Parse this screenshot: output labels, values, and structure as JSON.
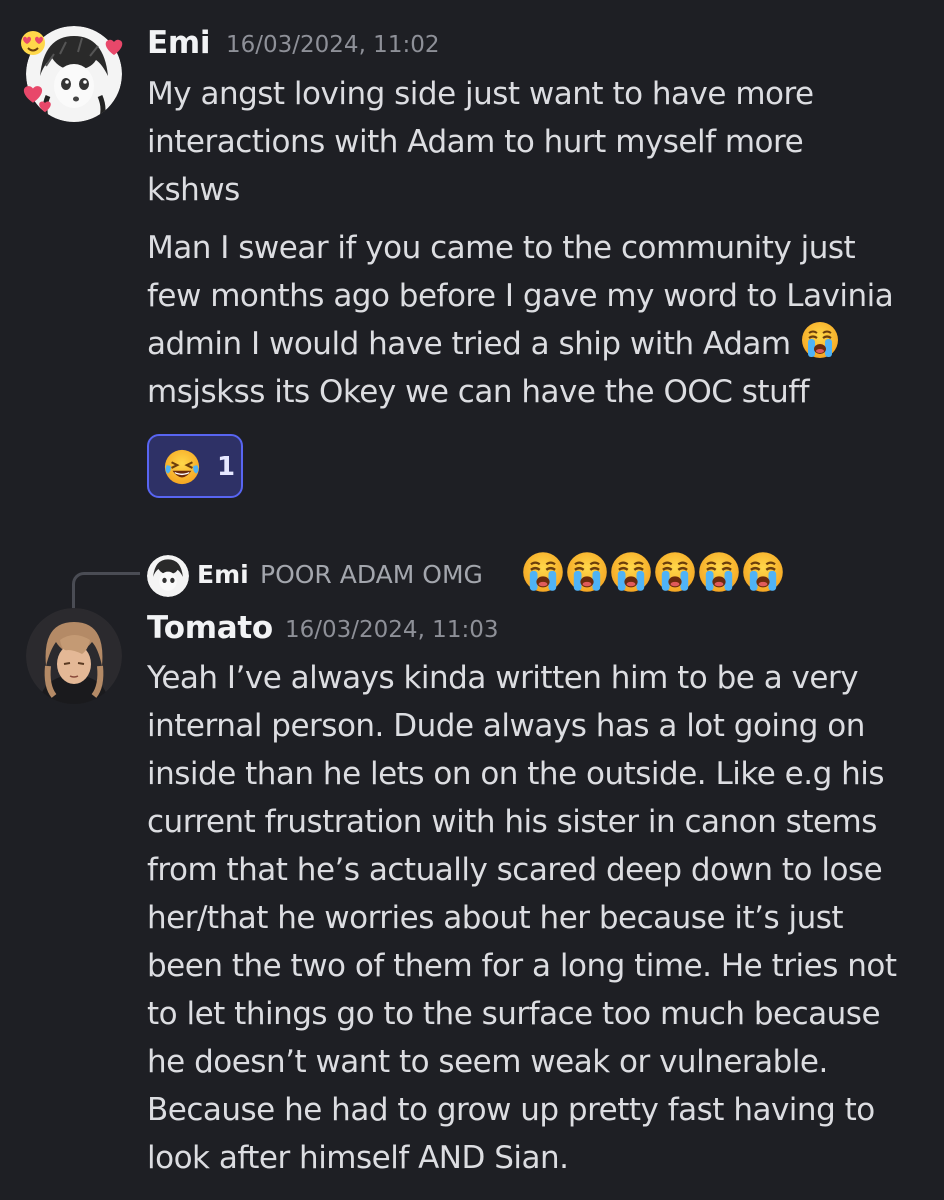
{
  "messages": [
    {
      "username": "Emi",
      "timestamp": "16/03/2024, 11:02",
      "avatar": "manga-girl-avatar",
      "paragraphs": [
        "My angst loving side just want to have more interactions with Adam to hurt myself more kshws",
        "Man I swear if you came to the community just few months ago before I gave my word to Lavinia admin I would have tried a ship with Adam",
        "msjskss its Okey we can have the OOC stuff"
      ],
      "reaction": {
        "emoji": "laughing-crying-emoji",
        "count": "1"
      }
    },
    {
      "username": "Tomato",
      "timestamp": "16/03/2024, 11:03",
      "avatar": "anime-character-avatar",
      "reply": {
        "username": "Emi",
        "text": "POOR ADAM OMG",
        "emoji": "loudly-crying-emoji",
        "emoji_count": 6
      },
      "paragraphs": [
        "Yeah I’ve always kinda written him to be a very internal person. Dude always has a lot going on inside than he lets on on the outside. Like e.g his current frustration with his sister in canon stems from that he’s actually scared deep down to lose her/that he worries about her because it’s just been the two of them for a long time. He tries not to let things go to the surface too much because he doesn’t want to seem weak or vulnerable. Because he had to grow up pretty fast having to look after himself AND Sian."
      ]
    }
  ],
  "colors": {
    "background": "#1e1f24",
    "text": "#dcdde1",
    "username": "#f2f3f5",
    "timestamp": "#8e9098",
    "reaction_border": "#5865f2",
    "reaction_bg": "#2e3166",
    "heart": "#e8486a"
  }
}
